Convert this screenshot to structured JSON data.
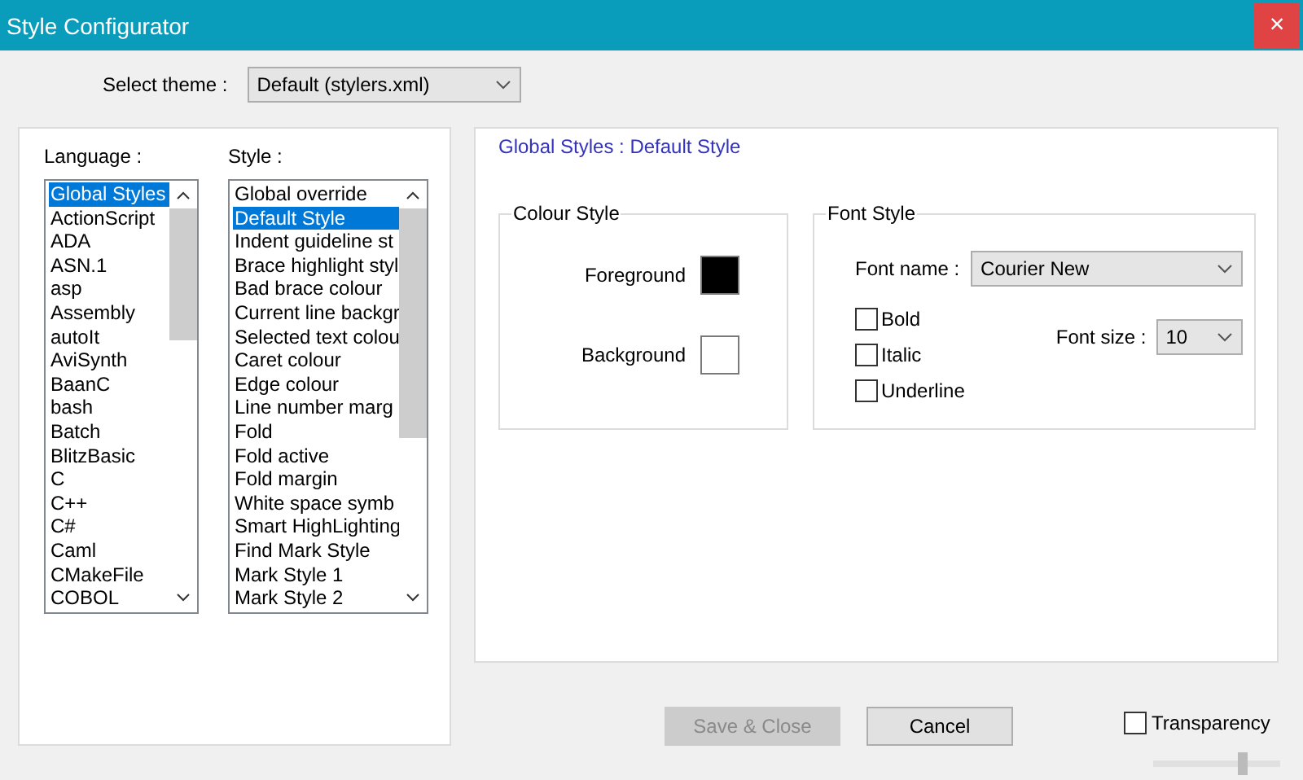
{
  "window": {
    "title": "Style Configurator",
    "close": "×"
  },
  "theme": {
    "label": "Select theme :",
    "value": "Default (stylers.xml)"
  },
  "language": {
    "label": "Language :",
    "items": [
      {
        "label": "Global Styles",
        "selected": true
      },
      {
        "label": "ActionScript",
        "selected": false
      },
      {
        "label": "ADA",
        "selected": false
      },
      {
        "label": "ASN.1",
        "selected": false
      },
      {
        "label": "asp",
        "selected": false
      },
      {
        "label": "Assembly",
        "selected": false
      },
      {
        "label": "autoIt",
        "selected": false
      },
      {
        "label": "AviSynth",
        "selected": false
      },
      {
        "label": "BaanC",
        "selected": false
      },
      {
        "label": "bash",
        "selected": false
      },
      {
        "label": "Batch",
        "selected": false
      },
      {
        "label": "BlitzBasic",
        "selected": false
      },
      {
        "label": "C",
        "selected": false
      },
      {
        "label": "C++",
        "selected": false
      },
      {
        "label": "C#",
        "selected": false
      },
      {
        "label": "Caml",
        "selected": false
      },
      {
        "label": "CMakeFile",
        "selected": false
      },
      {
        "label": "COBOL",
        "selected": false
      }
    ]
  },
  "style": {
    "label": "Style :",
    "items": [
      {
        "label": "Global override",
        "selected": false
      },
      {
        "label": "Default Style",
        "selected": true
      },
      {
        "label": "Indent guideline st",
        "selected": false
      },
      {
        "label": "Brace highlight styl",
        "selected": false
      },
      {
        "label": "Bad brace colour",
        "selected": false
      },
      {
        "label": "Current line backgr",
        "selected": false
      },
      {
        "label": "Selected text colou",
        "selected": false
      },
      {
        "label": "Caret colour",
        "selected": false
      },
      {
        "label": "Edge colour",
        "selected": false
      },
      {
        "label": "Line number marg",
        "selected": false
      },
      {
        "label": "Fold",
        "selected": false
      },
      {
        "label": "Fold active",
        "selected": false
      },
      {
        "label": "Fold margin",
        "selected": false
      },
      {
        "label": "White space symb",
        "selected": false
      },
      {
        "label": "Smart HighLighting",
        "selected": false
      },
      {
        "label": "Find Mark Style",
        "selected": false
      },
      {
        "label": "Mark Style 1",
        "selected": false
      },
      {
        "label": "Mark Style 2",
        "selected": false
      }
    ]
  },
  "heading": "Global Styles : Default Style",
  "colour_style": {
    "title": "Colour Style",
    "foreground": {
      "label": "Foreground",
      "color": "#000000"
    },
    "background": {
      "label": "Background",
      "color": "#ffffff"
    }
  },
  "font_style": {
    "title": "Font Style",
    "font_name_label": "Font name :",
    "font_name": "Courier New",
    "font_size_label": "Font size :",
    "font_size": "10",
    "options": [
      {
        "label": "Bold",
        "checked": false
      },
      {
        "label": "Italic",
        "checked": false
      },
      {
        "label": "Underline",
        "checked": false
      }
    ]
  },
  "buttons": [
    {
      "label": "Save & Close",
      "disabled": true
    },
    {
      "label": "Cancel",
      "disabled": false
    }
  ],
  "transparency": {
    "label": "Transparency",
    "checked": false,
    "level": 0.72
  }
}
